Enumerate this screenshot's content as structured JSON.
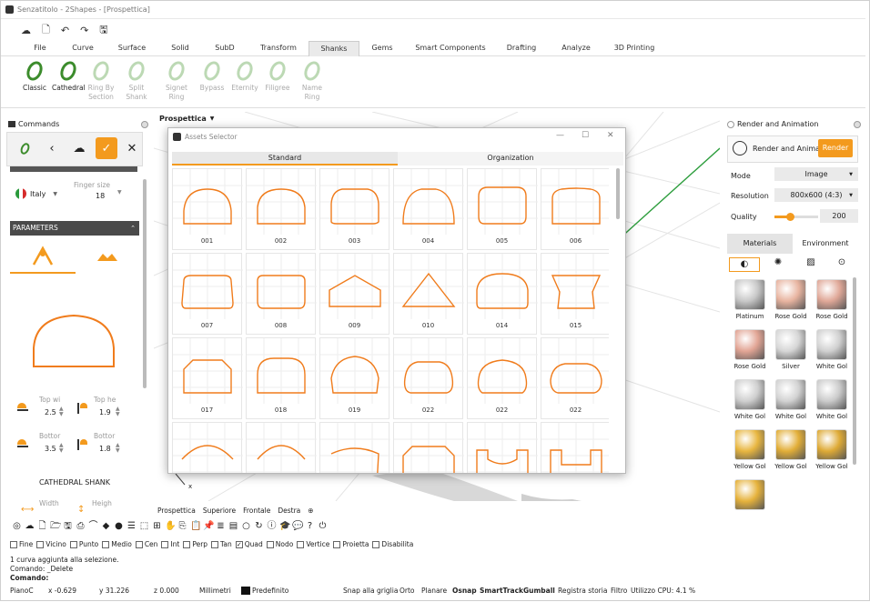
{
  "window": {
    "title": "Senzatitolo - 2Shapes - [Prospettica]"
  },
  "tabs": [
    "File",
    "Curve",
    "Surface",
    "Solid",
    "SubD",
    "Transform",
    "Shanks",
    "Gems",
    "Smart Components",
    "Drafting",
    "Analyze",
    "3D Printing"
  ],
  "active_tab": "Shanks",
  "ribbon": [
    {
      "label": "Classic",
      "label2": "",
      "enabled": true
    },
    {
      "label": "Cathedral",
      "label2": "",
      "enabled": true
    },
    {
      "label": "Ring By",
      "label2": "Section",
      "enabled": false
    },
    {
      "label": "Split Shank",
      "label2": "",
      "enabled": false
    },
    {
      "label": "Signet Ring",
      "label2": "",
      "enabled": false
    },
    {
      "label": "Bypass",
      "label2": "",
      "enabled": false
    },
    {
      "label": "Eternity",
      "label2": "",
      "enabled": false
    },
    {
      "label": "Filigree",
      "label2": "",
      "enabled": false
    },
    {
      "label": "Name Ring",
      "label2": "",
      "enabled": false
    }
  ],
  "commands_panel": {
    "title": "Commands",
    "country": "Italy",
    "finger_size_label": "Finger size",
    "finger_size_value": "18",
    "parameters_label": "PARAMETERS",
    "top_w_label": "Top wi",
    "top_w_value": "2.5",
    "top_h_label": "Top he",
    "top_h_value": "1.9",
    "bottom_w_label": "Bottor",
    "bottom_w_value": "3.5",
    "bottom_h_label": "Bottor",
    "bottom_h_value": "1.8",
    "shank_title": "CATHEDRAL SHANK",
    "width_label": "Width",
    "height_label": "Heigh"
  },
  "viewport": {
    "name": "Prospettica",
    "axis_label": "x"
  },
  "view_tabs": [
    "Prospettica",
    "Superiore",
    "Frontale",
    "Destra"
  ],
  "assets_dialog": {
    "title": "Assets Selector",
    "tabs": [
      "Standard",
      "Organization"
    ],
    "active_tab": "Standard",
    "items": [
      "001",
      "002",
      "003",
      "004",
      "005",
      "006",
      "007",
      "008",
      "009",
      "010",
      "014",
      "015",
      "017",
      "018",
      "019",
      "022",
      "022",
      "022",
      "",
      "",
      "",
      "",
      "",
      ""
    ]
  },
  "render_panel": {
    "title": "Render and Animation",
    "render_and_animat": "Render and Animat",
    "render_button": "Render",
    "mode_label": "Mode",
    "mode_value": "Image",
    "resolution_label": "Resolution",
    "resolution_value": "800x600 (4:3)",
    "quality_label": "Quality",
    "quality_value": "200",
    "quality_fraction": 0.35,
    "tabs": [
      "Materials",
      "Environment"
    ],
    "materials": [
      {
        "name": "Platinum",
        "color": "#c8c8c8"
      },
      {
        "name": "Rose Gold",
        "color": "#e8b4a0"
      },
      {
        "name": "Rose Gold",
        "color": "#e0a898"
      },
      {
        "name": "Rose Gold",
        "color": "#e2a595"
      },
      {
        "name": "Silver",
        "color": "#d6d6d6"
      },
      {
        "name": "White Gol",
        "color": "#d0d0d0"
      },
      {
        "name": "White Gol",
        "color": "#cfcfcf"
      },
      {
        "name": "White Gol",
        "color": "#d2d2d2"
      },
      {
        "name": "White Gol",
        "color": "#cbcbcb"
      },
      {
        "name": "Yellow Gol",
        "color": "#e8b640"
      },
      {
        "name": "Yellow Gol",
        "color": "#e2ae38"
      },
      {
        "name": "Yellow Gol",
        "color": "#deaa36"
      },
      {
        "name": "",
        "color": "#e6b23c"
      }
    ]
  },
  "snaps": [
    {
      "label": "Fine",
      "checked": false
    },
    {
      "label": "Vicino",
      "checked": false
    },
    {
      "label": "Punto",
      "checked": false
    },
    {
      "label": "Medio",
      "checked": false
    },
    {
      "label": "Cen",
      "checked": false
    },
    {
      "label": "Int",
      "checked": false
    },
    {
      "label": "Perp",
      "checked": false
    },
    {
      "label": "Tan",
      "checked": false
    },
    {
      "label": "Quad",
      "checked": true
    },
    {
      "label": "Nodo",
      "checked": false
    },
    {
      "label": "Vertice",
      "checked": false
    },
    {
      "label": "Proietta",
      "checked": false
    },
    {
      "label": "Disabilita",
      "checked": false
    }
  ],
  "command_history": [
    "1 curva aggiunta alla selezione.",
    "Comando: _Delete"
  ],
  "command_prompt": "Comando:",
  "statusbar": {
    "cplane": "PianoC",
    "x": "x -0.629",
    "y": "y 31.226",
    "z": "z 0.000",
    "units": "Millimetri",
    "layer": "Predefinito",
    "snap_grid": "Snap alla griglia",
    "orto": "Orto",
    "planare": "Planare",
    "osnap": "Osnap",
    "smarttrack": "SmartTrack",
    "gumball": "Gumball",
    "registra": "Registra storia",
    "filtro": "Filtro",
    "cpu": "Utilizzo CPU: 4.1 %"
  },
  "colors": {
    "accent": "#f39a1e",
    "profile": "#f07c1c",
    "panel_header": "#4a4a4a"
  }
}
